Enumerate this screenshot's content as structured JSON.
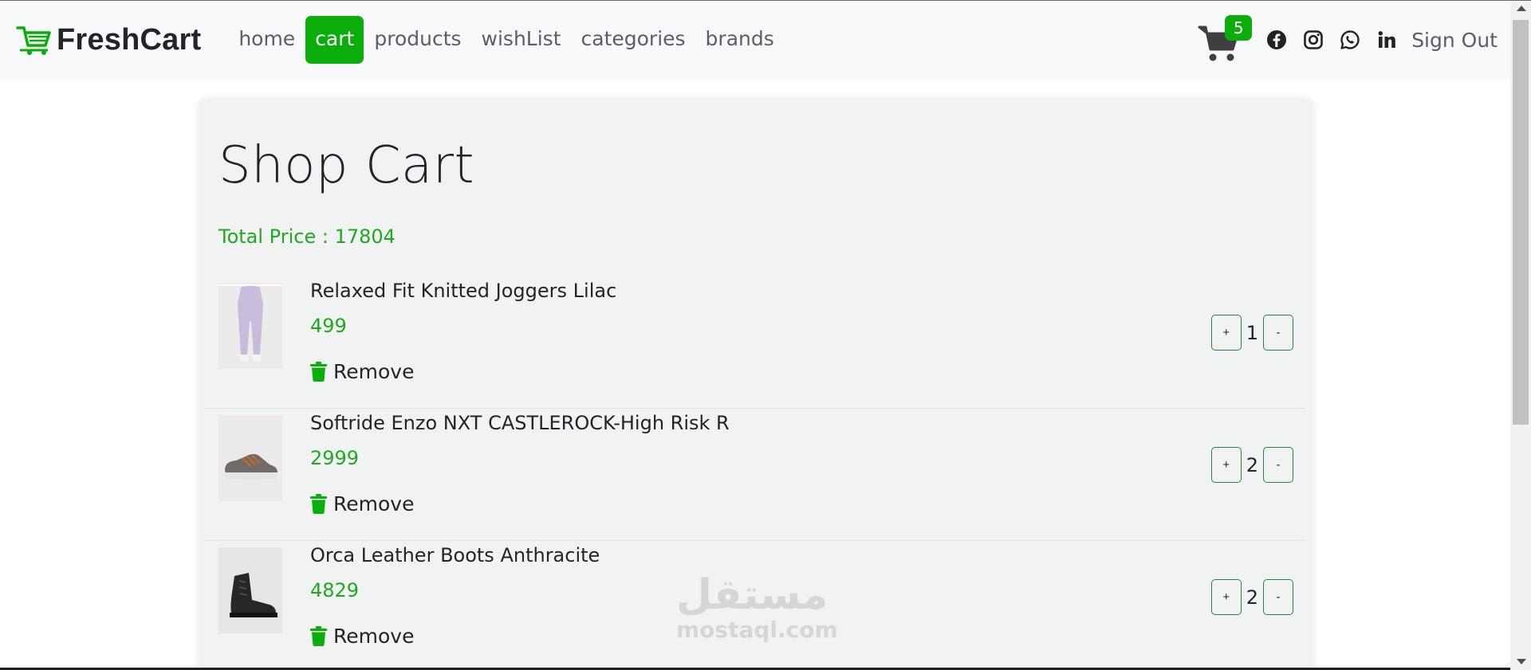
{
  "brand": {
    "name": "FreshCart",
    "accent": "#0aad0a"
  },
  "nav": {
    "links": [
      {
        "label": "home",
        "active": false
      },
      {
        "label": "cart",
        "active": true
      },
      {
        "label": "products",
        "active": false
      },
      {
        "label": "wishList",
        "active": false
      },
      {
        "label": "categories",
        "active": false
      },
      {
        "label": "brands",
        "active": false
      }
    ],
    "cart_count": "5",
    "social_icons": [
      "facebook-icon",
      "instagram-icon",
      "whatsapp-icon",
      "linkedin-icon"
    ],
    "signout_label": "Sign Out"
  },
  "cart": {
    "title": "Shop Cart",
    "total_label": "Total Price : 17804",
    "remove_label": "Remove",
    "items": [
      {
        "title": "Relaxed Fit Knitted Joggers Lilac",
        "price": "499",
        "quantity": "1",
        "plus": "+",
        "minus": "-"
      },
      {
        "title": "Softride Enzo NXT CASTLEROCK-High Risk R",
        "price": "2999",
        "quantity": "2",
        "plus": "+",
        "minus": "-"
      },
      {
        "title": "Orca Leather Boots Anthracite",
        "price": "4829",
        "quantity": "2",
        "plus": "+",
        "minus": "-"
      }
    ]
  },
  "watermark": {
    "arabic": "مستقل",
    "latin": "mostaql.com"
  }
}
